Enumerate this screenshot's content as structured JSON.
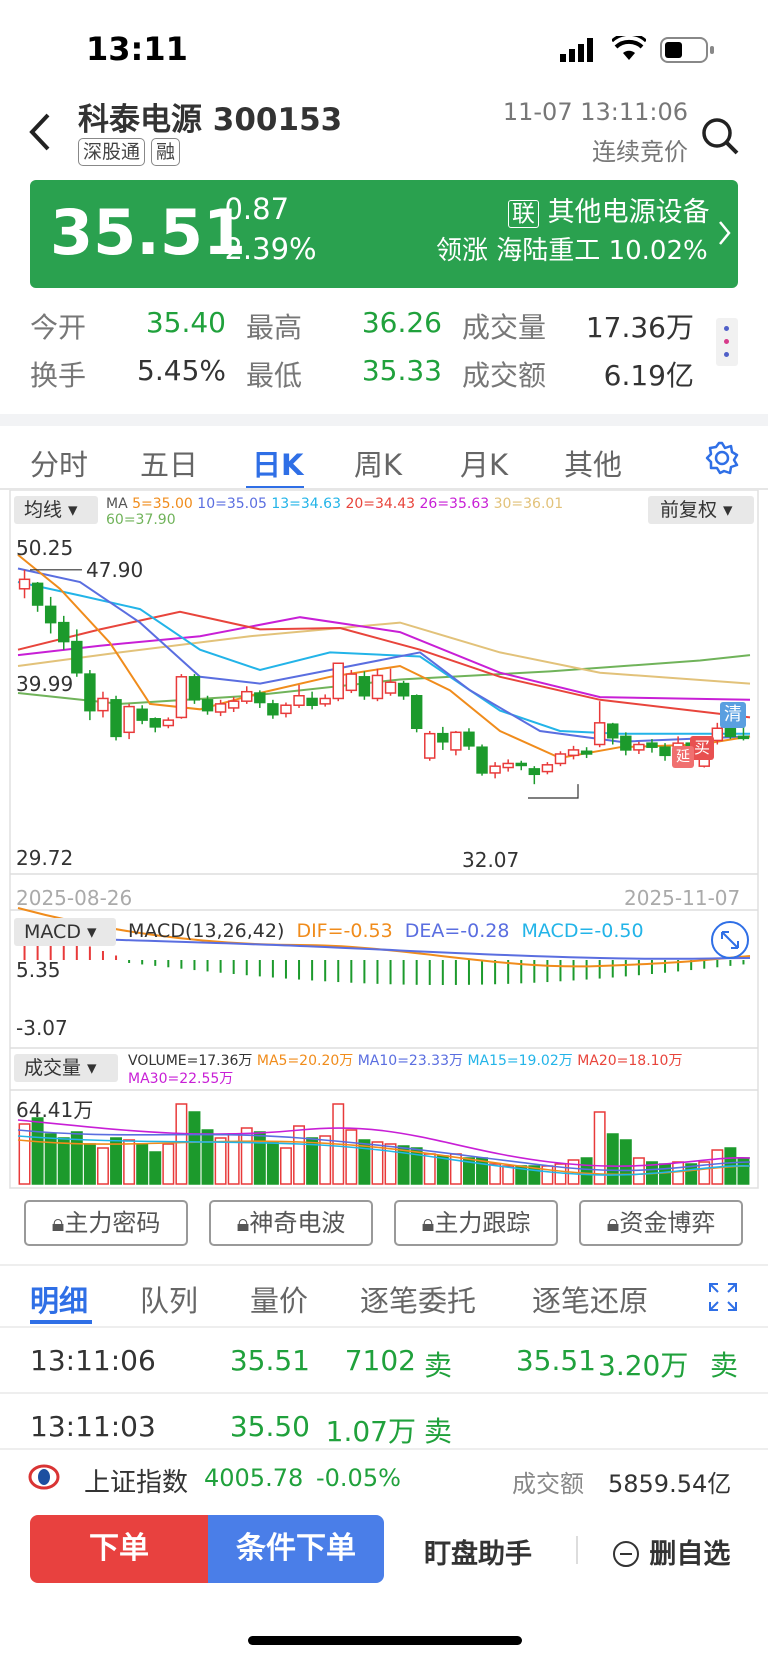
{
  "status": {
    "time": "13:11"
  },
  "header": {
    "name": "科泰电源",
    "code": "300153",
    "tags": [
      "深股通",
      "融"
    ],
    "datetime": "11-07 13:11:06",
    "phase": "连续竞价"
  },
  "price": {
    "last": "35.51",
    "change": "-0.87",
    "change_pct": "-2.39%",
    "sector_tag": "联",
    "sector": "其他电源设备",
    "leader_label": "领涨",
    "leader_name": "海陆重工",
    "leader_pct": "10.02%",
    "bar_color": "#2aa14f"
  },
  "quote": {
    "open_label": "今开",
    "open": "35.40",
    "high_label": "最高",
    "high": "36.26",
    "vol_label": "成交量",
    "vol": "17.36万",
    "turnover_label": "换手",
    "turnover": "5.45%",
    "low_label": "最低",
    "low": "35.33",
    "amount_label": "成交额",
    "amount": "6.19亿"
  },
  "tabs": [
    "分时",
    "五日",
    "日K",
    "周K",
    "月K",
    "其他"
  ],
  "active_tab": "日K",
  "kline": {
    "ma_button": "均线",
    "fq_button": "前复权",
    "ma_title": "MA",
    "ma_items": [
      {
        "text": "5=35.00",
        "color": "#f08c1c"
      },
      {
        "text": "10=35.05",
        "color": "#5a6ee0"
      },
      {
        "text": "13=34.63",
        "color": "#23b4e8"
      },
      {
        "text": "20=34.43",
        "color": "#e8453c"
      },
      {
        "text": "26=35.63",
        "color": "#c81fd6"
      },
      {
        "text": "30=36.01",
        "color": "#e2c27a"
      },
      {
        "text": "60=37.90",
        "color": "#70b35a"
      }
    ],
    "y_top": "50.25",
    "y_mid": "39.99",
    "y_bottom": "29.72",
    "max_label": "47.90",
    "min_label": "32.07",
    "date_start": "2025-08-26",
    "date_end": "2025-11-07",
    "markers": {
      "clear": "清",
      "buy": "买",
      "extend": "延"
    }
  },
  "macd": {
    "button": "MACD",
    "title": "MACD(13,26,42)",
    "dif": "DIF=-0.53",
    "dea": "DEA=-0.28",
    "macd": "MACD=-0.50",
    "y_top": "5.35",
    "y_bottom": "-3.07"
  },
  "volume": {
    "button": "成交量",
    "vol": "VOLUME=17.36万",
    "ma5": "MA5=20.20万",
    "ma10": "MA10=23.33万",
    "ma15": "MA15=19.02万",
    "ma20": "MA20=18.10万",
    "ma30": "MA30=22.55万",
    "y_top": "64.41万"
  },
  "tools": [
    "主力密码",
    "神奇电波",
    "主力跟踪",
    "资金博弈"
  ],
  "subtabs": [
    "明细",
    "队列",
    "量价",
    "逐笔委托",
    "逐笔还原"
  ],
  "active_subtab": "明细",
  "trades": [
    {
      "time": "13:11:06",
      "price": "35.51",
      "qty": "7102",
      "side": "卖",
      "price2": "35.51",
      "qty2": "3.20万",
      "side2": "卖"
    },
    {
      "time": "13:11:03",
      "price": "35.50",
      "qty": "1.07万",
      "side": "卖"
    }
  ],
  "index": {
    "name": "上证指数",
    "value": "4005.78",
    "pct": "-0.05%",
    "amount_label": "成交额",
    "amount": "5859.54亿"
  },
  "actions": {
    "order": "下单",
    "cond_order": "条件下单",
    "assistant": "盯盘助手",
    "remove": "删自选"
  }
}
